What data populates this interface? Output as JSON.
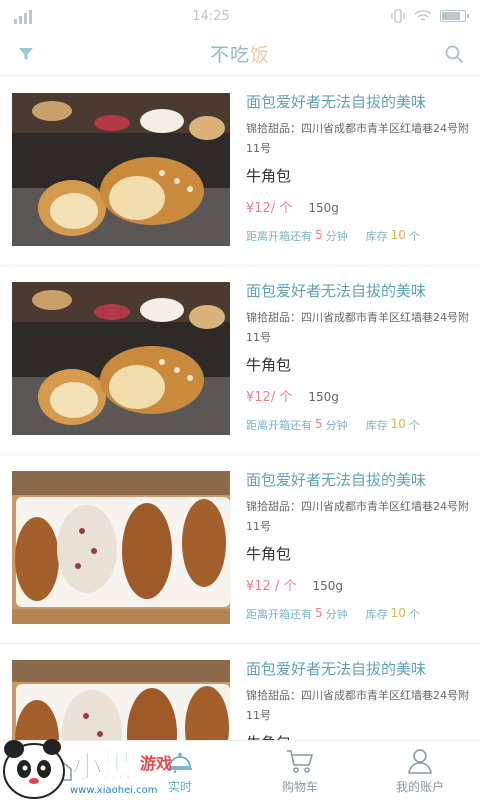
{
  "status": {
    "time": "14:25"
  },
  "header": {
    "title_main": "不吃",
    "title_accent": "饭"
  },
  "listing": {
    "items": [
      {
        "title": "面包爱好者无法自拔的美味",
        "address": "锦拾甜品：四川省成都市青羊区红墙巷24号附11号",
        "name": "牛角包",
        "price": "¥12/ 个",
        "weight": "150g",
        "countdown_prefix": "距离开箱还有",
        "countdown_value": "5",
        "countdown_unit": "分钟",
        "stock_prefix": "库存",
        "stock_value": "10",
        "stock_unit": "个",
        "image": "dark-croissant"
      },
      {
        "title": "面包爱好者无法自拔的美味",
        "address": "锦拾甜品：四川省成都市青羊区红墙巷24号附11号",
        "name": "牛角包",
        "price": "¥12/ 个",
        "weight": "150g",
        "countdown_prefix": "距离开箱还有",
        "countdown_value": "5",
        "countdown_unit": "分钟",
        "stock_prefix": "库存",
        "stock_value": "10",
        "stock_unit": "个",
        "image": "dark-croissant"
      },
      {
        "title": "面包爱好者无法自拔的美味",
        "address": "锦拾甜品：四川省成都市青羊区红墙巷24号附11号",
        "name": "牛角包",
        "price": "¥12 / 个",
        "weight": "150g",
        "countdown_prefix": "距离开箱还有",
        "countdown_value": "5",
        "countdown_unit": "分钟",
        "stock_prefix": "库存",
        "stock_value": "10",
        "stock_unit": "个",
        "image": "tray-croissants"
      },
      {
        "title": "面包爱好者无法自拔的美味",
        "address": "锦拾甜品：四川省成都市青羊区红墙巷24号附11号",
        "name": "牛角包",
        "price": "",
        "weight": "",
        "countdown_prefix": "",
        "countdown_value": "",
        "countdown_unit": "",
        "stock_prefix": "",
        "stock_value": "",
        "stock_unit": "",
        "image": "tray-croissants"
      }
    ]
  },
  "tabs": [
    {
      "label": "",
      "icon": "home-icon"
    },
    {
      "label": "实时",
      "icon": "realtime-bell-icon",
      "active": true
    },
    {
      "label": "购物车",
      "icon": "cart-icon"
    },
    {
      "label": "我的账户",
      "icon": "user-icon"
    }
  ],
  "watermark": {
    "brand": "小黑游戏",
    "url": "www.xiaohei.com"
  },
  "colors": {
    "accent": "#6aaec2",
    "title_accent": "#f3cda0",
    "price": "#f07b8a",
    "stock": "#d9b45a"
  }
}
